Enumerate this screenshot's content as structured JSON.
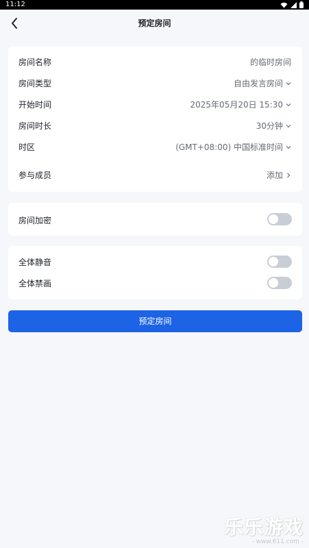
{
  "status_bar": {
    "time": "11:12",
    "icons": [
      "wifi-icon",
      "signal-icon",
      "battery-icon"
    ]
  },
  "header": {
    "title": "预定房间",
    "back_icon": "chevron-left-icon"
  },
  "form": {
    "room_name": {
      "label": "房间名称",
      "value": "的临时房间"
    },
    "room_type": {
      "label": "房间类型",
      "value": "自由发言房间"
    },
    "start_time": {
      "label": "开始时间",
      "value": "2025年05月20日 15:30"
    },
    "duration": {
      "label": "房间时长",
      "value": "30分钟"
    },
    "timezone": {
      "label": "时区",
      "value": "(GMT+08:00) 中国标准时间"
    },
    "members": {
      "label": "参与成员",
      "value": "添加"
    }
  },
  "encryption": {
    "label": "房间加密",
    "enabled": false
  },
  "controls": {
    "mute_all": {
      "label": "全体静音",
      "enabled": false
    },
    "disable_video": {
      "label": "全体禁画",
      "enabled": false
    }
  },
  "submit": {
    "label": "预定房间"
  },
  "colors": {
    "accent": "#1d63e6",
    "page_bg": "#f6f7fb",
    "toggle_off": "#c9cdd6"
  },
  "watermark": {
    "main": "乐乐游戏",
    "sub": "- www.611.com -"
  }
}
